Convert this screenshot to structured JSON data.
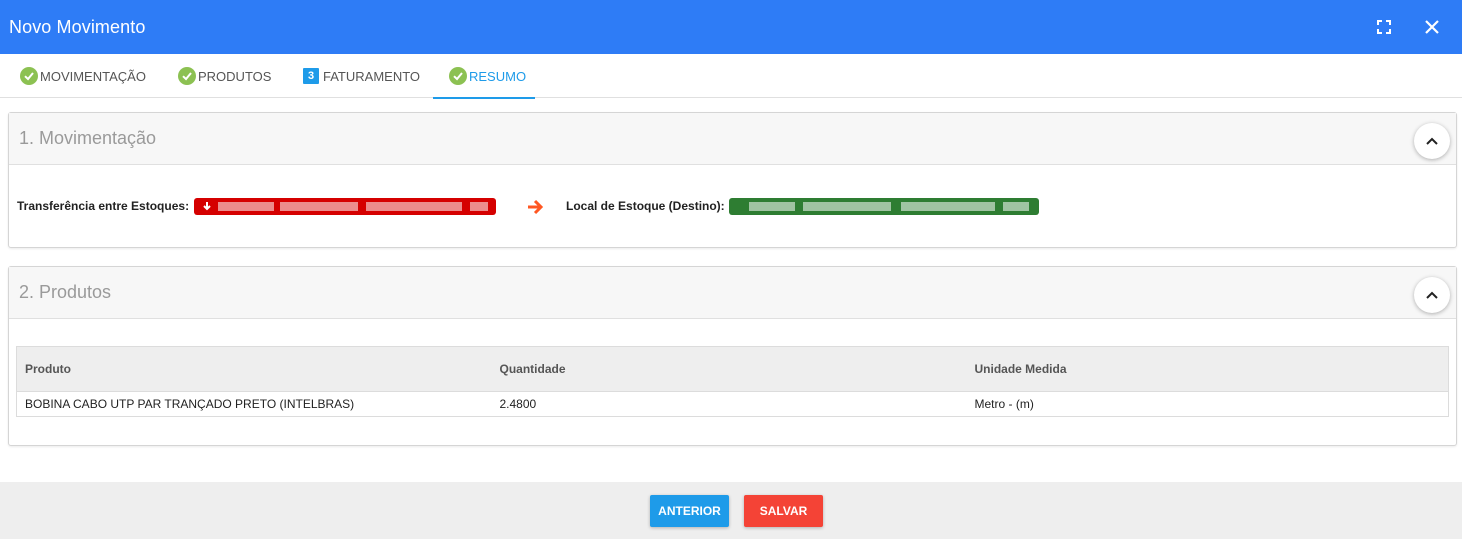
{
  "window": {
    "title": "Novo Movimento"
  },
  "icons": {
    "fullscreen": "fullscreen-icon",
    "close": "close-icon",
    "check": "check-circle-icon",
    "arrow": "arrow-right-icon",
    "collapse": "chevron-up-icon",
    "down": "arrow-down-icon"
  },
  "tabs": [
    {
      "label": "MOVIMENTAÇÃO",
      "state": "done"
    },
    {
      "label": "PRODUTOS",
      "state": "done"
    },
    {
      "label": "FATURAMENTO",
      "state": "step",
      "step": "3"
    },
    {
      "label": "RESUMO",
      "state": "done-active"
    }
  ],
  "movimentacao": {
    "title": "1. Movimentação",
    "origem_label": "Transferência entre Estoques:",
    "destino_label": "Local de Estoque (Destino):"
  },
  "produtos": {
    "title": "2. Produtos",
    "columns": [
      "Produto",
      "Quantidade",
      "Unidade Medida"
    ],
    "rows": [
      [
        "BOBINA CABO UTP PAR TRANÇADO PRETO (INTELBRAS)",
        "2.4800",
        "Metro - (m)"
      ]
    ]
  },
  "footer": {
    "prev_label": "ANTERIOR",
    "save_label": "SALVAR"
  },
  "colors": {
    "header": "#2e7cf6",
    "accent": "#1e9be9",
    "check": "#8cc152",
    "origin": "#d50000",
    "destination": "#2e7d32",
    "save": "#f44336",
    "arrow": "#ff5722"
  }
}
